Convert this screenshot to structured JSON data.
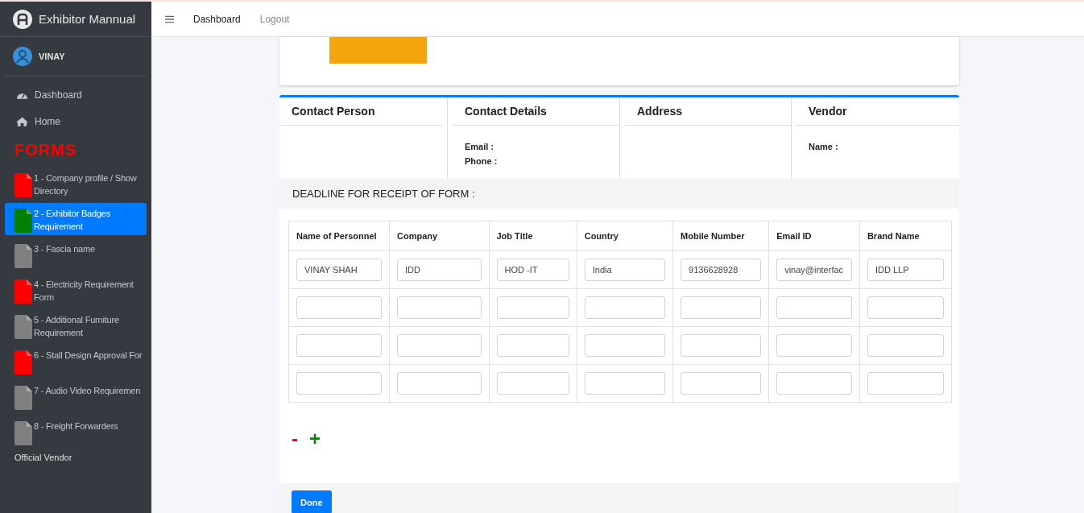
{
  "brand": {
    "title": "Exhibitor Mannual"
  },
  "user": {
    "name": "VINAY"
  },
  "nav": [
    {
      "label": "Dashboard",
      "kind": "dashboard"
    },
    {
      "label": "Home",
      "kind": "home"
    }
  ],
  "forms_heading": "FORMS",
  "forms": [
    {
      "label": "1 - Company profile / Show Directory",
      "color": "#ff0000",
      "selected": false
    },
    {
      "label": "2 - Exhibitor Badges Requirement",
      "color": "#008000",
      "selected": true
    },
    {
      "label": "3 - Fascia name",
      "color": "#808080",
      "selected": false
    },
    {
      "label": "4 - Electricity Requirement Form",
      "color": "#ff0000",
      "selected": false
    },
    {
      "label": "5 - Additional Furniture Requirement",
      "color": "#808080",
      "selected": false
    },
    {
      "label": "6 - Stall Design Approval For",
      "color": "#ff0000",
      "selected": false
    },
    {
      "label": "7 - Audio Video Requiremen",
      "color": "#808080",
      "selected": false
    },
    {
      "label": "8 - Freight Forwarders",
      "color": "#808080",
      "selected": false
    }
  ],
  "sidebar_footer": "Official Vendor",
  "topbar": {
    "links": [
      "Dashboard",
      "Logout"
    ]
  },
  "info": [
    {
      "title": "Contact Person"
    },
    {
      "title": "Contact Details",
      "fields": [
        "Email :",
        "Phone :"
      ]
    },
    {
      "title": "Address"
    },
    {
      "title": "Vendor",
      "fields": [
        "Name :"
      ]
    }
  ],
  "deadline": "DEADLINE FOR RECEIPT OF FORM :",
  "table": {
    "columns": [
      "Name of Personnel",
      "Company",
      "Job Title",
      "Country",
      "Mobile Number",
      "Email ID",
      "Brand Name"
    ],
    "rows": [
      {
        "kind": "filled",
        "cells": [
          "VINAY SHAH",
          "IDD",
          "HOD -IT",
          "India",
          "9136628928",
          "vinay@interfac",
          "IDD LLP"
        ]
      },
      {
        "kind": "blank"
      },
      {
        "kind": "blank"
      },
      {
        "kind": "blank"
      }
    ]
  },
  "row_controls": [
    "-",
    "+"
  ],
  "done_button": "Done"
}
